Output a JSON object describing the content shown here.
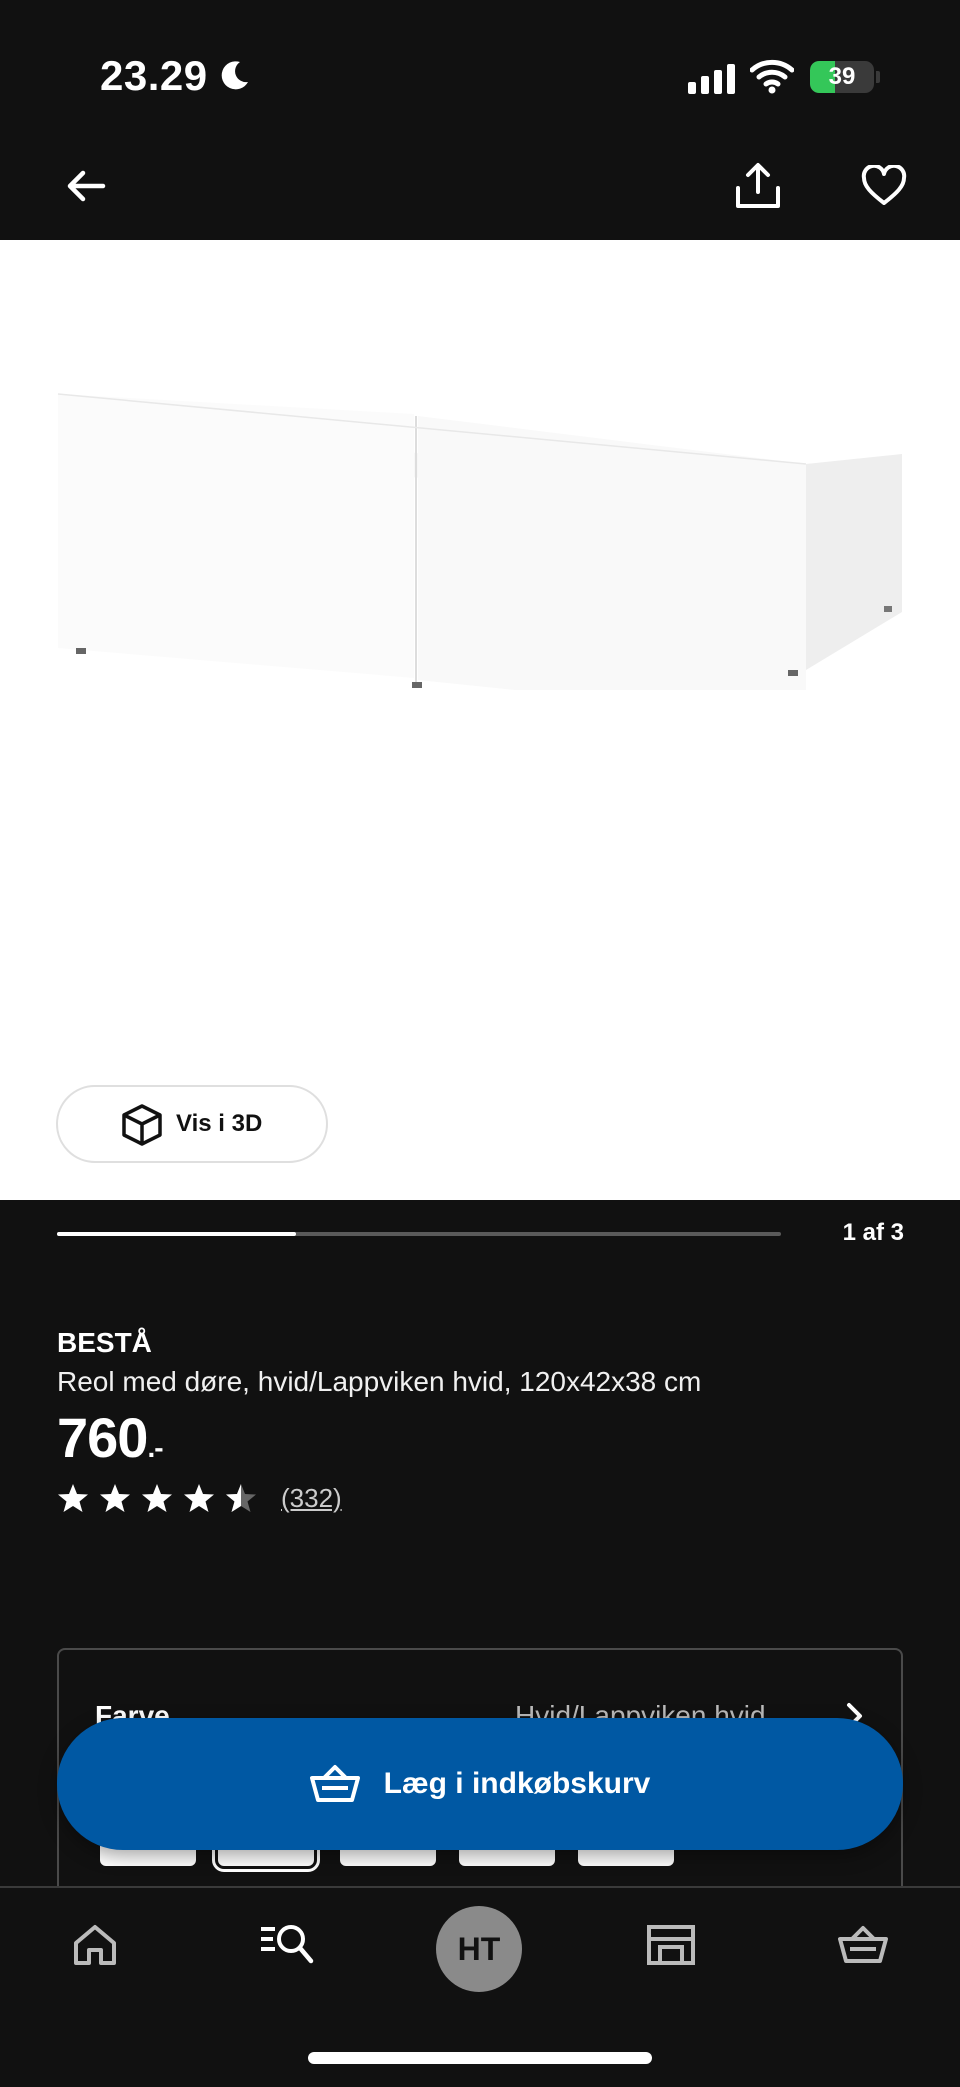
{
  "status_bar": {
    "time": "23.29",
    "battery": "39",
    "battery_level": 0.39,
    "colors": {
      "battery_fill": "#34c759"
    }
  },
  "header": {
    "back_icon": "arrow-left-icon",
    "share_icon": "share-icon",
    "favorite_icon": "heart-icon"
  },
  "gallery": {
    "view3d_label": "Vis i 3D",
    "pager_text": "1 af 3",
    "pager_progress": 0.33
  },
  "product": {
    "brand": "BESTÅ",
    "description": "Reol med døre, hvid/Lappviken hvid, 120x42x38 cm",
    "price": "760",
    "price_suffix": ".-",
    "rating": 4.5,
    "review_count": "(332)"
  },
  "color_selector": {
    "label": "Farve",
    "value": "Hvid/Lappviken hvid"
  },
  "cart_button": {
    "label": "Læg i indkøbskurv",
    "color": "#0058a3"
  },
  "bottom_nav": {
    "profile_initials": "HT",
    "items": [
      "home-icon",
      "search-list-icon",
      "profile-avatar",
      "store-icon",
      "basket-icon"
    ]
  }
}
